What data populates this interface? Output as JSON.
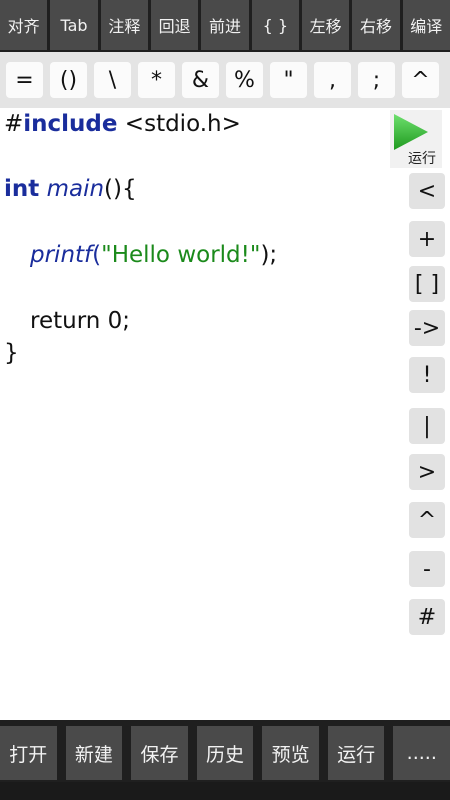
{
  "top_toolbar": {
    "buttons": [
      "对齐",
      "Tab",
      "注释",
      "回退",
      "前进",
      "{ }",
      "左移",
      "右移",
      "编译"
    ]
  },
  "symbol_bar": {
    "keys": [
      "=",
      "()",
      "\\",
      "*",
      "&",
      "%",
      "\"",
      ",",
      ";",
      "^"
    ]
  },
  "editor": {
    "line1_hash": "#",
    "line1_kw": "include",
    "line1_rest": " <stdio.h>",
    "line3_type": "int",
    "line3_fn": "main",
    "line3_rest": "(){",
    "line5_fn": "printf",
    "line5_open": "(",
    "line5_str": "\"Hello world!\"",
    "line5_close": ");",
    "line7_text": "return 0;",
    "line8_text": "}"
  },
  "run_button": {
    "label": "运行",
    "color": "#2fb12f"
  },
  "side_keys": [
    "<",
    "+",
    "[ ]",
    "->",
    "!",
    "|",
    ">",
    "^",
    "-",
    "#"
  ],
  "bottom_toolbar": {
    "buttons": [
      "打开",
      "新建",
      "保存",
      "历史",
      "预览",
      "运行",
      "....."
    ]
  },
  "colors": {
    "keyword": "#1a2d9c",
    "string": "#1b8a1b",
    "toolbar_bg": "#4a4a4a"
  }
}
